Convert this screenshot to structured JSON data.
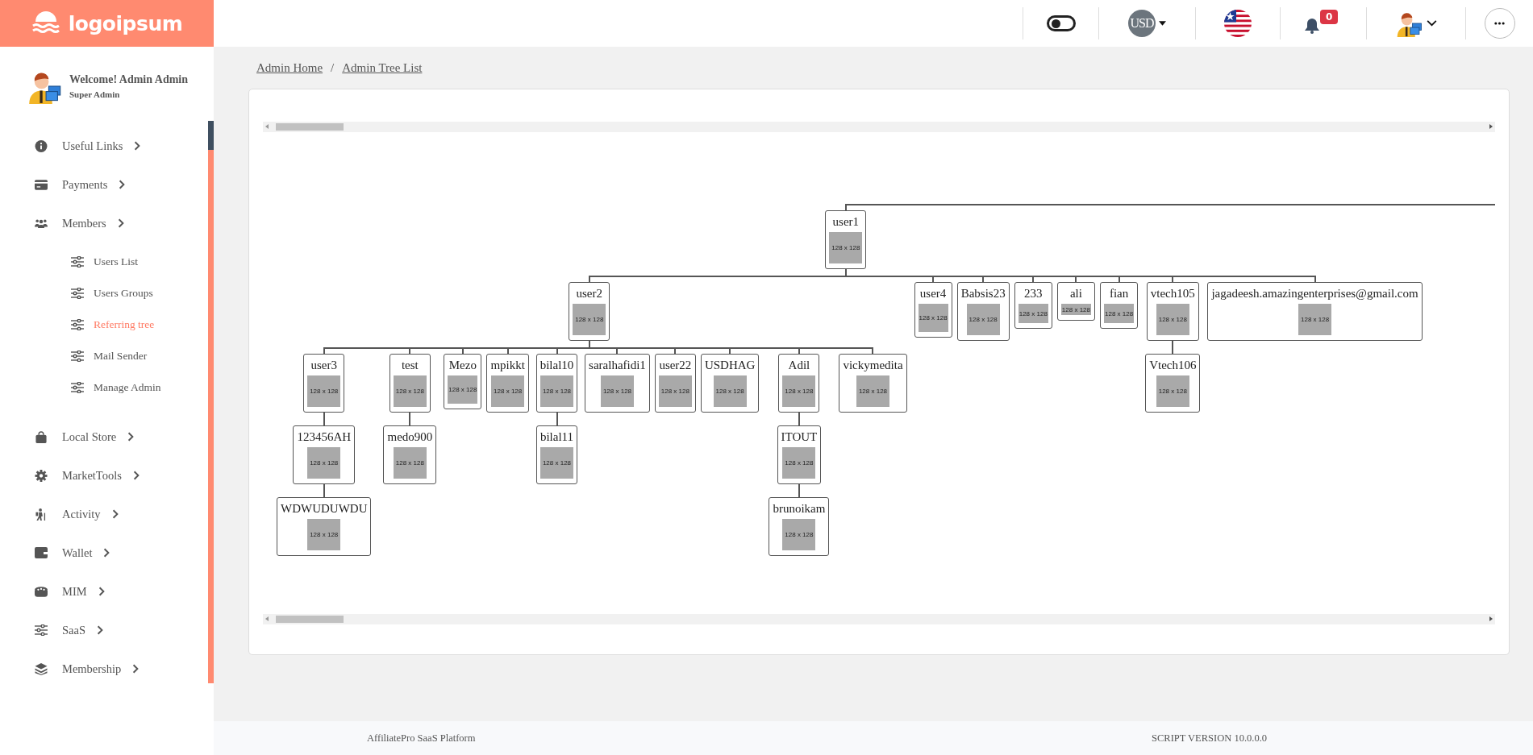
{
  "brand": {
    "logo_text": "logoipsum"
  },
  "header": {
    "theme_toggle": {
      "on": false
    },
    "currency": "USD",
    "notification_count": "0"
  },
  "profile": {
    "welcome": "Welcome! Admin Admin",
    "role": "Super Admin"
  },
  "sidebar": {
    "items": [
      {
        "label": "Useful Links"
      },
      {
        "label": "Payments"
      },
      {
        "label": "Members",
        "children": [
          {
            "label": "Users List",
            "selected": false
          },
          {
            "label": "Users Groups",
            "selected": false
          },
          {
            "label": "Referring tree",
            "selected": true
          },
          {
            "label": "Mail Sender",
            "selected": false
          },
          {
            "label": "Manage Admin",
            "selected": false
          }
        ]
      },
      {
        "label": "Local Store"
      },
      {
        "label": "MarketTools"
      },
      {
        "label": "Activity"
      },
      {
        "label": "Wallet"
      },
      {
        "label": "MIM"
      },
      {
        "label": "SaaS"
      },
      {
        "label": "Membership"
      }
    ]
  },
  "breadcrumb": {
    "items": [
      {
        "label": "Admin Home"
      },
      {
        "label": "Admin Tree List"
      }
    ],
    "separator": "/"
  },
  "tree": {
    "name": "user1",
    "image": {
      "label": "128 x 128",
      "kind": "large"
    },
    "children": [
      {
        "name": "user2",
        "image": {
          "label": "128 x 128",
          "kind": "large"
        },
        "children": [
          {
            "name": "user3",
            "image": {
              "label": "128 x 128",
              "kind": "large"
            },
            "children": [
              {
                "name": "123456AH",
                "image": {
                  "label": "128 x 128",
                  "kind": "large"
                },
                "children": [
                  {
                    "name": "WDWUDUWDU",
                    "image": {
                      "label": "128 x 128",
                      "kind": "large"
                    }
                  }
                ]
              }
            ]
          },
          {
            "name": "test",
            "image": {
              "label": "128 x 128",
              "kind": "large"
            },
            "children": [
              {
                "name": "medo900",
                "image": {
                  "label": "128 x 128",
                  "kind": "large"
                }
              }
            ]
          },
          {
            "name": "Mezo",
            "image": {
              "label": "128 x 128",
              "kind": "medium"
            }
          },
          {
            "name": "mpikkt",
            "image": {
              "label": "128 x 128",
              "kind": "large"
            }
          },
          {
            "name": "bilal10",
            "image": {
              "label": "128 x 128",
              "kind": "large"
            },
            "children": [
              {
                "name": "bilal11",
                "image": {
                  "label": "128 x 128",
                  "kind": "large"
                }
              }
            ]
          },
          {
            "name": "saralhafidi1",
            "image": {
              "label": "128 x 128",
              "kind": "large"
            }
          },
          {
            "name": "user22",
            "image": {
              "label": "128 x 128",
              "kind": "large"
            }
          },
          {
            "name": "USDHAG",
            "image": {
              "label": "128 x 128",
              "kind": "large"
            }
          },
          {
            "name": "Adil",
            "image": {
              "label": "128 x 128",
              "kind": "large"
            },
            "children": [
              {
                "name": "ITOUT",
                "image": {
                  "label": "128 x 128",
                  "kind": "large"
                },
                "children": [
                  {
                    "name": "brunoikam",
                    "image": {
                      "label": "128 x 128",
                      "kind": "large"
                    }
                  }
                ]
              }
            ]
          },
          {
            "name": "vickymedita",
            "image": {
              "label": "128 x 128",
              "kind": "large"
            }
          }
        ]
      },
      {
        "name": "user4",
        "image": {
          "label": "128 x 128",
          "kind": "medium"
        }
      },
      {
        "name": "Babsis23",
        "image": {
          "label": "128 x 128",
          "kind": "large"
        }
      },
      {
        "name": "233",
        "image": {
          "label": "128 x 128",
          "kind": "small"
        }
      },
      {
        "name": "ali",
        "image": {
          "label": "128 x 128",
          "kind": "tiny"
        }
      },
      {
        "name": "fian",
        "image": {
          "label": "128 x 128",
          "kind": "small"
        }
      },
      {
        "name": "vtech105",
        "image": {
          "label": "128 x 128",
          "kind": "large"
        },
        "children": [
          {
            "name": "Vtech106",
            "image": {
              "label": "128 x 128",
              "kind": "large"
            }
          }
        ]
      },
      {
        "name": "jagadeesh.amazingenterprises@gmail.com",
        "image": {
          "label": "128 x 128",
          "kind": "large"
        }
      }
    ]
  },
  "footer": {
    "platform": "AffiliatePro SaaS Platform",
    "version": "SCRIPT VERSION 10.0.0.0"
  }
}
